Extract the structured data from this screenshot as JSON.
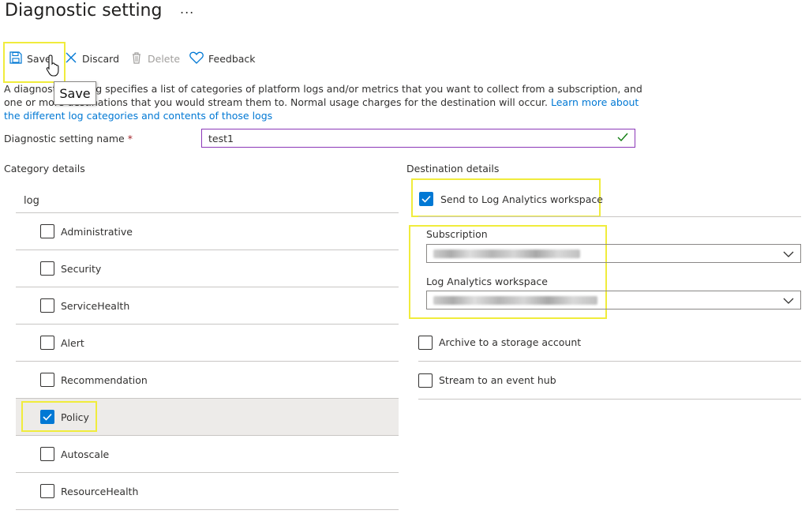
{
  "page": {
    "title": "Diagnostic setting",
    "more_label": "..."
  },
  "toolbar": {
    "save_label": "Save",
    "discard_label": "Discard",
    "delete_label": "Delete",
    "feedback_label": "Feedback",
    "tooltip_text": "Save"
  },
  "description": {
    "text": "A diagnostic setting specifies a list of categories of platform logs and/or metrics that you want to collect from a subscription, and one or more destinations that you would stream them to. Normal usage charges for the destination will occur.",
    "link_text": "Learn more about the different log categories and contents of those logs"
  },
  "setting_name": {
    "label": "Diagnostic setting name",
    "required_marker": "*",
    "value": "test1"
  },
  "category_details": {
    "heading": "Category details",
    "group_label": "log",
    "items": [
      {
        "label": "Administrative",
        "checked": false
      },
      {
        "label": "Security",
        "checked": false
      },
      {
        "label": "ServiceHealth",
        "checked": false
      },
      {
        "label": "Alert",
        "checked": false
      },
      {
        "label": "Recommendation",
        "checked": false
      },
      {
        "label": "Policy",
        "checked": true
      },
      {
        "label": "Autoscale",
        "checked": false
      },
      {
        "label": "ResourceHealth",
        "checked": false
      }
    ]
  },
  "destination_details": {
    "heading": "Destination details",
    "log_analytics": {
      "label": "Send to Log Analytics workspace",
      "checked": true
    },
    "subscription_label": "Subscription",
    "workspace_label": "Log Analytics workspace",
    "archive": {
      "label": "Archive to a storage account",
      "checked": false
    },
    "event_hub": {
      "label": "Stream to an event hub",
      "checked": false
    }
  },
  "colors": {
    "accent": "#0078d4",
    "highlight": "#f0ec3c",
    "input_focus": "#8c38b8",
    "valid_check": "#107c10"
  }
}
